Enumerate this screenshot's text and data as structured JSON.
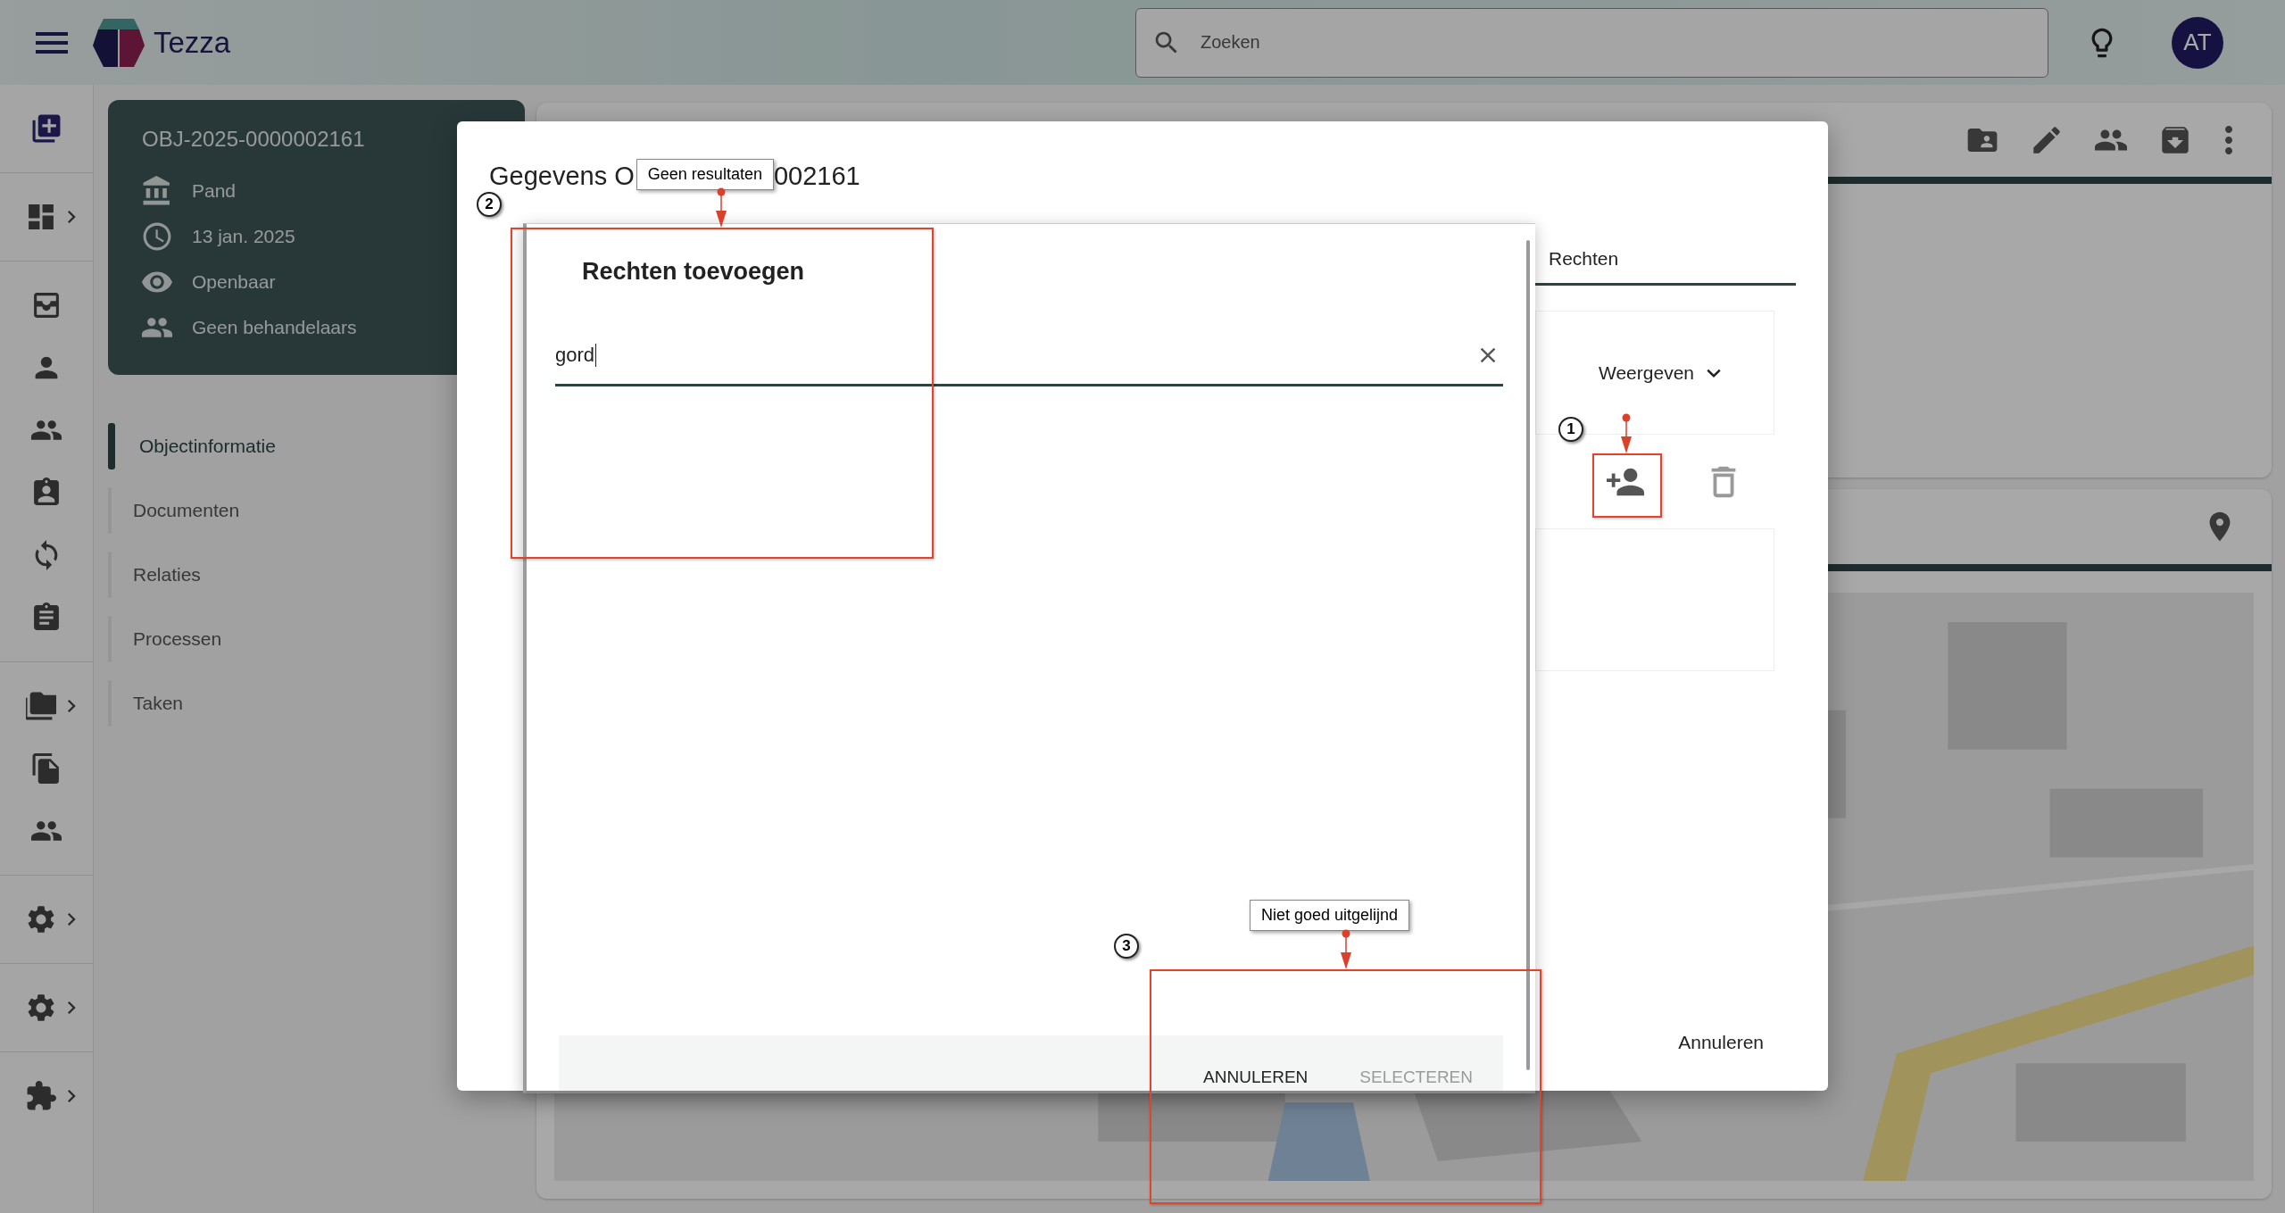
{
  "header": {
    "app_name": "Tezza",
    "search": {
      "placeholder": "Zoeken"
    },
    "avatar": "AT"
  },
  "rail": {
    "groups": [
      [
        {
          "expandable": false
        }
      ],
      [
        {
          "expandable": true
        }
      ],
      [
        {
          "expandable": false
        },
        {
          "expandable": false
        },
        {
          "expandable": false
        },
        {
          "expandable": false
        },
        {
          "expandable": false
        },
        {
          "expandable": false
        }
      ],
      [
        {
          "expandable": true
        },
        {
          "expandable": false
        },
        {
          "expandable": false
        }
      ],
      [
        {
          "expandable": true
        }
      ],
      [
        {
          "expandable": true
        }
      ],
      [
        {
          "expandable": true
        }
      ]
    ]
  },
  "object_card": {
    "id": "OBJ-2025-0000002161",
    "fields": [
      "Pand",
      "13 jan. 2025",
      "Openbaar",
      "Geen behandelaars"
    ]
  },
  "nav": [
    {
      "label": "Objectinformatie",
      "selected": true
    },
    {
      "label": "Documenten",
      "selected": false
    },
    {
      "label": "Relaties",
      "selected": false
    },
    {
      "label": "Processen",
      "selected": false
    },
    {
      "label": "Taken",
      "selected": false
    }
  ],
  "dialog": {
    "title_start": "Gegevens O",
    "title_end": "002161",
    "tab": {
      "label": "Rechten",
      "selected": true
    },
    "view_select": "Weergeven",
    "cancel": "Annuleren"
  },
  "add_rights_dialog": {
    "title": "Rechten toevoegen",
    "search": {
      "value": "gord"
    },
    "buttons": [
      {
        "label": "ANNULEREN",
        "disabled": false
      },
      {
        "label": "SELECTEREN",
        "disabled": true
      }
    ]
  },
  "annotations": [
    {
      "number": "1"
    },
    {
      "number": "2",
      "label": "Geen resultaten"
    },
    {
      "number": "3",
      "label": "Niet goed uitgelijnd"
    }
  ]
}
